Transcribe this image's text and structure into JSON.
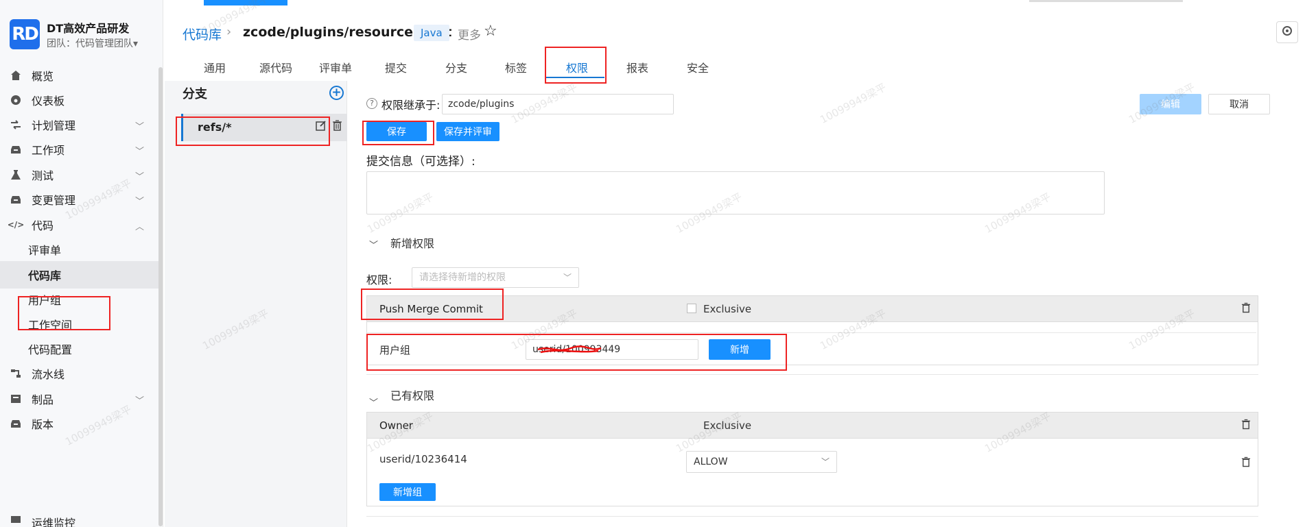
{
  "brand": {
    "logo": "RD",
    "title": "DT高效产品研发",
    "team": "团队：代码管理团队▾"
  },
  "sidebar": {
    "items": [
      {
        "label": "概览",
        "icon": "home-icon"
      },
      {
        "label": "仪表板",
        "icon": "dashboard-icon"
      },
      {
        "label": "计划管理",
        "icon": "plan-icon"
      },
      {
        "label": "工作项",
        "icon": "inbox-icon"
      },
      {
        "label": "测试",
        "icon": "flask-icon"
      },
      {
        "label": "变更管理",
        "icon": "inbox-icon"
      },
      {
        "label": "代码",
        "icon": "code-icon"
      },
      {
        "label": "流水线",
        "icon": "pipeline-icon"
      },
      {
        "label": "制品",
        "icon": "artifact-icon"
      },
      {
        "label": "版本",
        "icon": "inbox-icon"
      },
      {
        "label": "运维监控",
        "icon": "monitor-icon"
      }
    ],
    "code_sub": [
      "评审单",
      "代码库",
      "用户组",
      "工作空间",
      "代码配置"
    ]
  },
  "header": {
    "breadcrumb_root": "代码库",
    "repo_path": "zcode/plugins/resource-limit",
    "language": "Java",
    "more": "更多",
    "tabs": [
      "通用",
      "源代码",
      "评审单",
      "提交",
      "分支",
      "标签",
      "权限",
      "报表",
      "安全"
    ],
    "active_tab": "权限"
  },
  "branch_panel": {
    "title": "分支",
    "branches": [
      "refs/*"
    ]
  },
  "form": {
    "inherit_label": "权限继承于:",
    "inherit_value": "zcode/plugins",
    "edit": "编辑",
    "cancel": "取消",
    "save": "保存",
    "save_review": "保存并评审",
    "commit_label": "提交信息（可选择）:",
    "new_section": "新增权限",
    "perm_label": "权限:",
    "perm_placeholder": "请选择待新增的权限",
    "new_perm": {
      "name": "Push Merge Commit",
      "exclusive": "Exclusive",
      "usergroup_label": "用户组",
      "usergroup_value": "userid/100993449",
      "add": "新增"
    },
    "existing_section": "已有权限",
    "existing": {
      "name": "Owner",
      "exclusive": "Exclusive",
      "user": "userid/10236414",
      "value": "ALLOW",
      "add_group": "新增组"
    }
  },
  "watermark": "10099949梁平",
  "colors": {
    "accent": "#1890ff",
    "link": "#1677d2",
    "highlight": "#e22222"
  }
}
